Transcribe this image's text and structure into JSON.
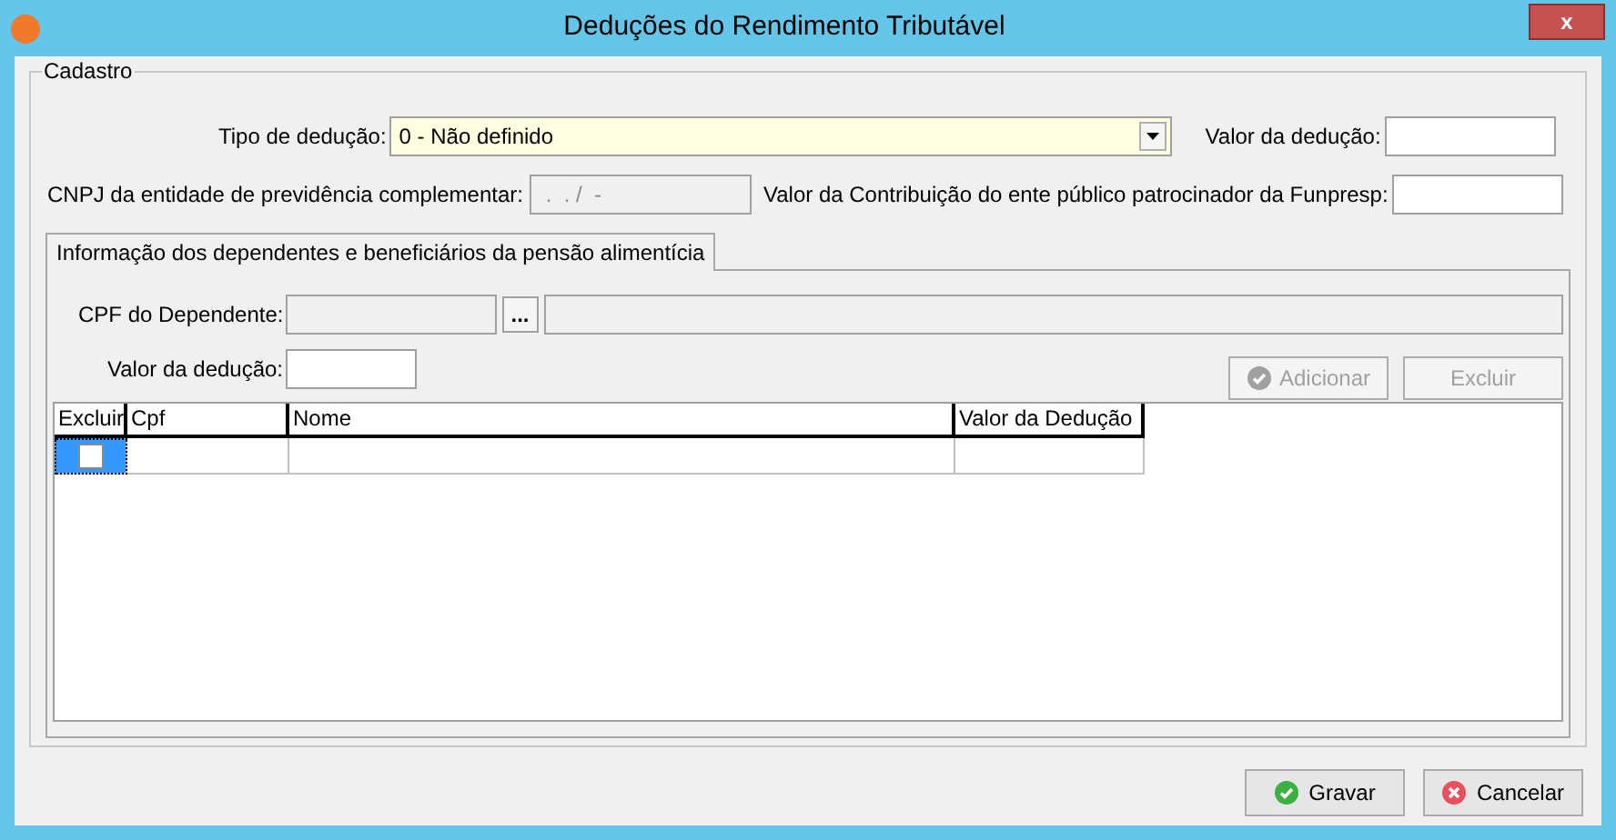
{
  "window": {
    "title": "Deduções do Rendimento Tributável",
    "close": "x"
  },
  "group": {
    "title": "Cadastro"
  },
  "tipo": {
    "label": "Tipo de dedução:",
    "value": "0 - Não definido"
  },
  "valor_deducao": {
    "label": "Valor da dedução:"
  },
  "cnpj": {
    "label": "CNPJ da entidade de previdência complementar:",
    "value": " .  . /  -",
    "disabled": true
  },
  "funpresp": {
    "label": "Valor da Contribuição do ente público patrocinador da Funpresp:"
  },
  "tabs": [
    {
      "label": "Informação dos dependentes e beneficiários da pensão alimentícia",
      "selected": true
    }
  ],
  "cpf": {
    "label": "CPF do Dependente:",
    "button": "...",
    "disabled": true
  },
  "dep_valor": {
    "label": "Valor da dedução:"
  },
  "actions": [
    {
      "label": "Adicionar",
      "kind": "check",
      "disabled": true
    },
    {
      "label": "Excluir",
      "kind": "plain",
      "disabled": true
    }
  ],
  "table": {
    "columns": [
      "Excluir",
      "Cpf",
      "Nome",
      "Valor da Dedução"
    ],
    "rows": [
      {
        "checked": false,
        "selected": true
      }
    ]
  },
  "buttons": [
    {
      "label": "Gravar",
      "kind": "check"
    },
    {
      "label": "Cancelar",
      "kind": "cancel"
    }
  ]
}
